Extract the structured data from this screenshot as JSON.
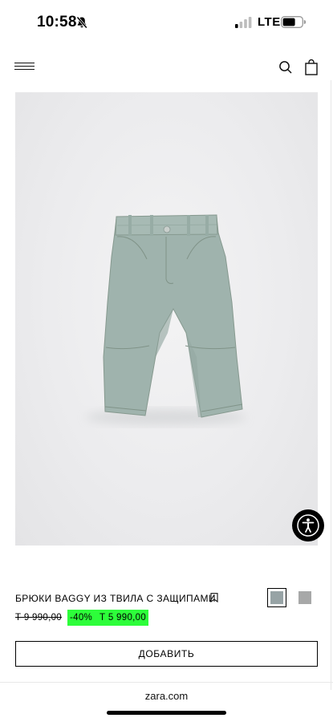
{
  "status_bar": {
    "time": "10:58",
    "network": "LTE",
    "icons": [
      "bell-slash-icon",
      "signal-icon",
      "battery-icon"
    ]
  },
  "header": {
    "icons": [
      "menu-icon",
      "search-icon",
      "shopping-bag-icon"
    ]
  },
  "product": {
    "name": "БРЮКИ BAGGY ИЗ ТВИЛА С ЗАЩИПАМИ",
    "price_old": "Т 9 990,00",
    "discount": "-40%",
    "price_new": "Т 5 990,00",
    "add_button_label": "ДОБАВИТЬ",
    "colors": [
      {
        "name": "swatch-sage",
        "hex": "#97a3a5",
        "selected": true
      },
      {
        "name": "swatch-grey",
        "hex": "#a7a8a8",
        "selected": false
      }
    ]
  },
  "browser": {
    "url": "zara.com"
  },
  "theme": {
    "sale_highlight": "#2dfd3a",
    "text": "#000000"
  }
}
